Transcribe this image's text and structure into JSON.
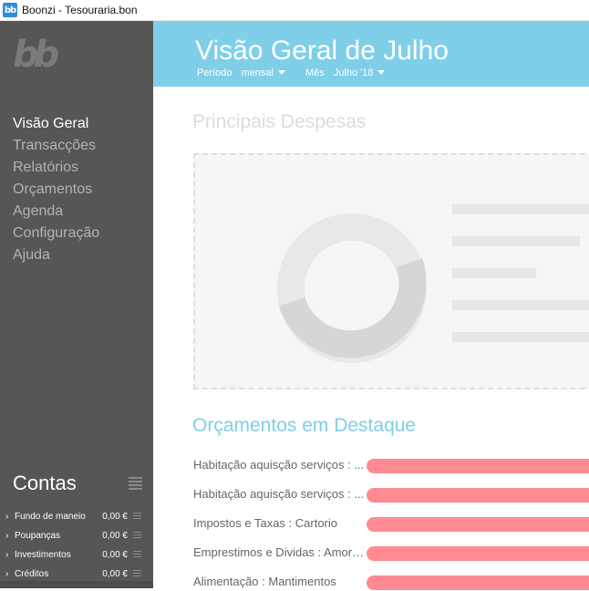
{
  "window": {
    "title": "Boonzi - Tesouraria.bon",
    "app_icon": "bb"
  },
  "sidebar": {
    "logo": "bb",
    "nav": [
      {
        "label": "Visão Geral",
        "active": true
      },
      {
        "label": "Transacções",
        "active": false
      },
      {
        "label": "Relatórios",
        "active": false
      },
      {
        "label": "Orçamentos",
        "active": false
      },
      {
        "label": "Agenda",
        "active": false
      },
      {
        "label": "Configuração",
        "active": false
      },
      {
        "label": "Ajuda",
        "active": false
      }
    ],
    "accounts_title": "Contas",
    "accounts": [
      {
        "name": "Fundo de maneio",
        "value": "0,00 €"
      },
      {
        "name": "Poupanças",
        "value": "0,00 €"
      },
      {
        "name": "Investimentos",
        "value": "0,00 €"
      },
      {
        "name": "Créditos",
        "value": "0,00 €"
      }
    ]
  },
  "header": {
    "title": "Visão Geral de Julho",
    "period_label": "Período",
    "period_value": "mensal",
    "month_label": "Mês",
    "month_value": "Julho '18"
  },
  "main": {
    "expenses_title": "Principais Despesas",
    "budgets_title": "Orçamentos em Destaque",
    "budgets": [
      {
        "label": "Habitação aquisção serviços  : ..."
      },
      {
        "label": "Habitação aquisção serviços  : ..."
      },
      {
        "label": "Impostos e Taxas  : Cartorio"
      },
      {
        "label": "Emprestimos e Dividas : Amorti..."
      },
      {
        "label": "Alimentação : Mantimentos"
      }
    ]
  },
  "colors": {
    "sidebar": "#565656",
    "header": "#7fcfe8",
    "budget_bar": "#ff8a92",
    "accent": "#7fcfe8"
  }
}
